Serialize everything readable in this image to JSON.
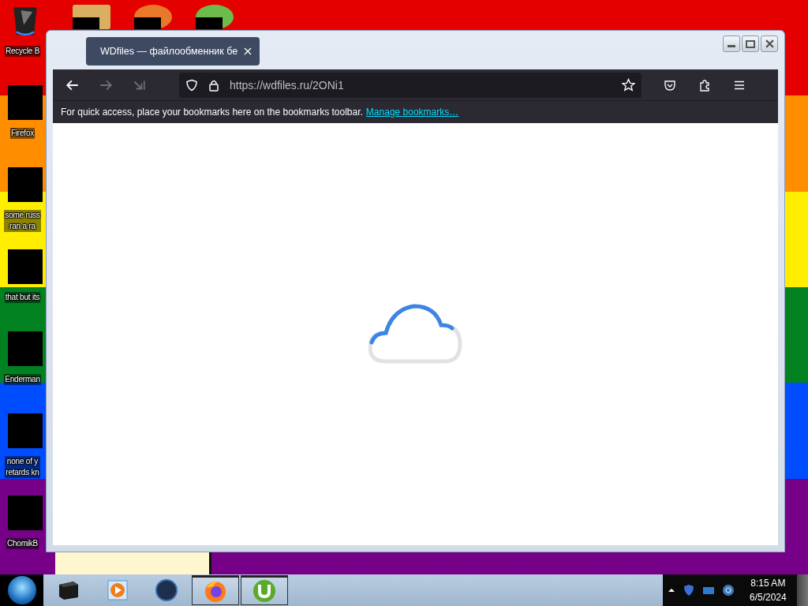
{
  "desktop": {
    "icons": [
      {
        "label": "Recycle B",
        "kind": "bin"
      },
      {
        "label": "Firefox",
        "kind": "redacted"
      },
      {
        "label": "some russ\nran a ra",
        "kind": "redacted"
      },
      {
        "label": "that but its",
        "kind": "redacted"
      },
      {
        "label": "Enderman",
        "kind": "redacted"
      },
      {
        "label": "none of y\nretards kn",
        "kind": "redacted"
      },
      {
        "label": "ChomikB",
        "kind": "redacted"
      }
    ]
  },
  "browser": {
    "tab": {
      "title": "WDfiles — файлообменник бе",
      "selected": true
    },
    "nav": [
      {
        "kind": "back",
        "disabled": false
      },
      {
        "kind": "forward",
        "disabled": true
      },
      {
        "kind": "skip",
        "disabled": true
      }
    ],
    "url": "https://wdfiles.ru/2ONi1",
    "bookmarks_bar": {
      "message": "For quick access, place your bookmarks here on the bookmarks toolbar.",
      "link": "Manage bookmarks…"
    },
    "content": {
      "kind": "loading"
    }
  },
  "taskbar": {
    "items": [
      {
        "kind": "box",
        "running": false
      },
      {
        "kind": "player",
        "running": false
      },
      {
        "kind": "globe",
        "running": false
      },
      {
        "kind": "firefox",
        "running": true
      },
      {
        "kind": "torrent",
        "running": true
      }
    ],
    "clock": {
      "time": "8:15 AM",
      "date": "6/5/2024"
    }
  }
}
